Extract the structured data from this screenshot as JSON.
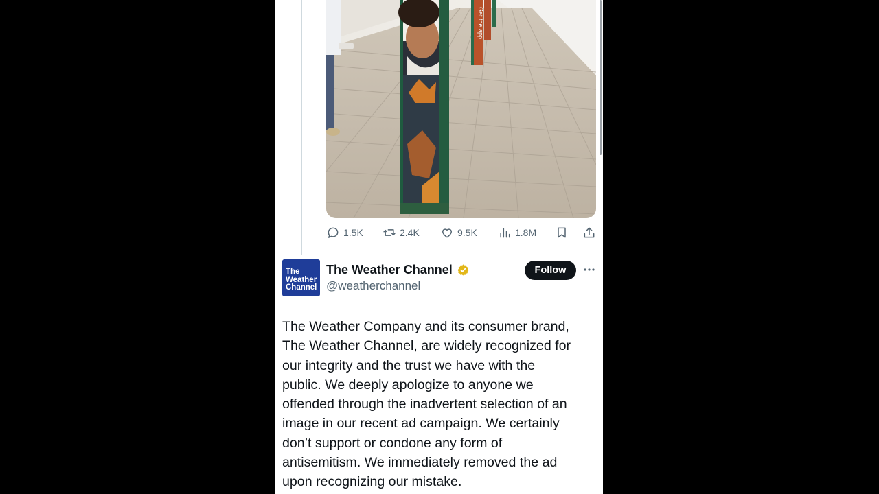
{
  "previous_tweet": {
    "stats": {
      "replies": "1.5K",
      "reposts": "2.4K",
      "likes": "9.5K",
      "views": "1.8M"
    },
    "icons": {
      "reply": "reply-icon",
      "repost": "repost-icon",
      "like": "heart-icon",
      "views": "views-icon",
      "bookmark": "bookmark-icon",
      "share": "share-icon"
    },
    "media": {
      "pillar_text": "Get the app"
    }
  },
  "tweet": {
    "avatar_lines": [
      "The",
      "Weather",
      "Channel"
    ],
    "display_name": "The Weather Channel",
    "handle": "@weatherchannel",
    "follow_label": "Follow",
    "text": "The Weather Company and its consumer brand,\nThe Weather Channel, are widely recognized for\nour integrity and the trust we have with the\npublic. We deeply apologize to anyone we\noffended through the inadvertent selection of an\nimage in our recent ad campaign. We certainly\ndon’t support or condone any form of\nantisemitism. We immediately removed the ad\nupon recognizing our mistake."
  },
  "colors": {
    "background": "#000000",
    "panel": "#ffffff",
    "text_primary": "#0f1419",
    "text_secondary": "#536471",
    "follow_bg": "#0f1419",
    "verified_gold": "#e2b719",
    "avatar_blue": "#1f3d99"
  }
}
